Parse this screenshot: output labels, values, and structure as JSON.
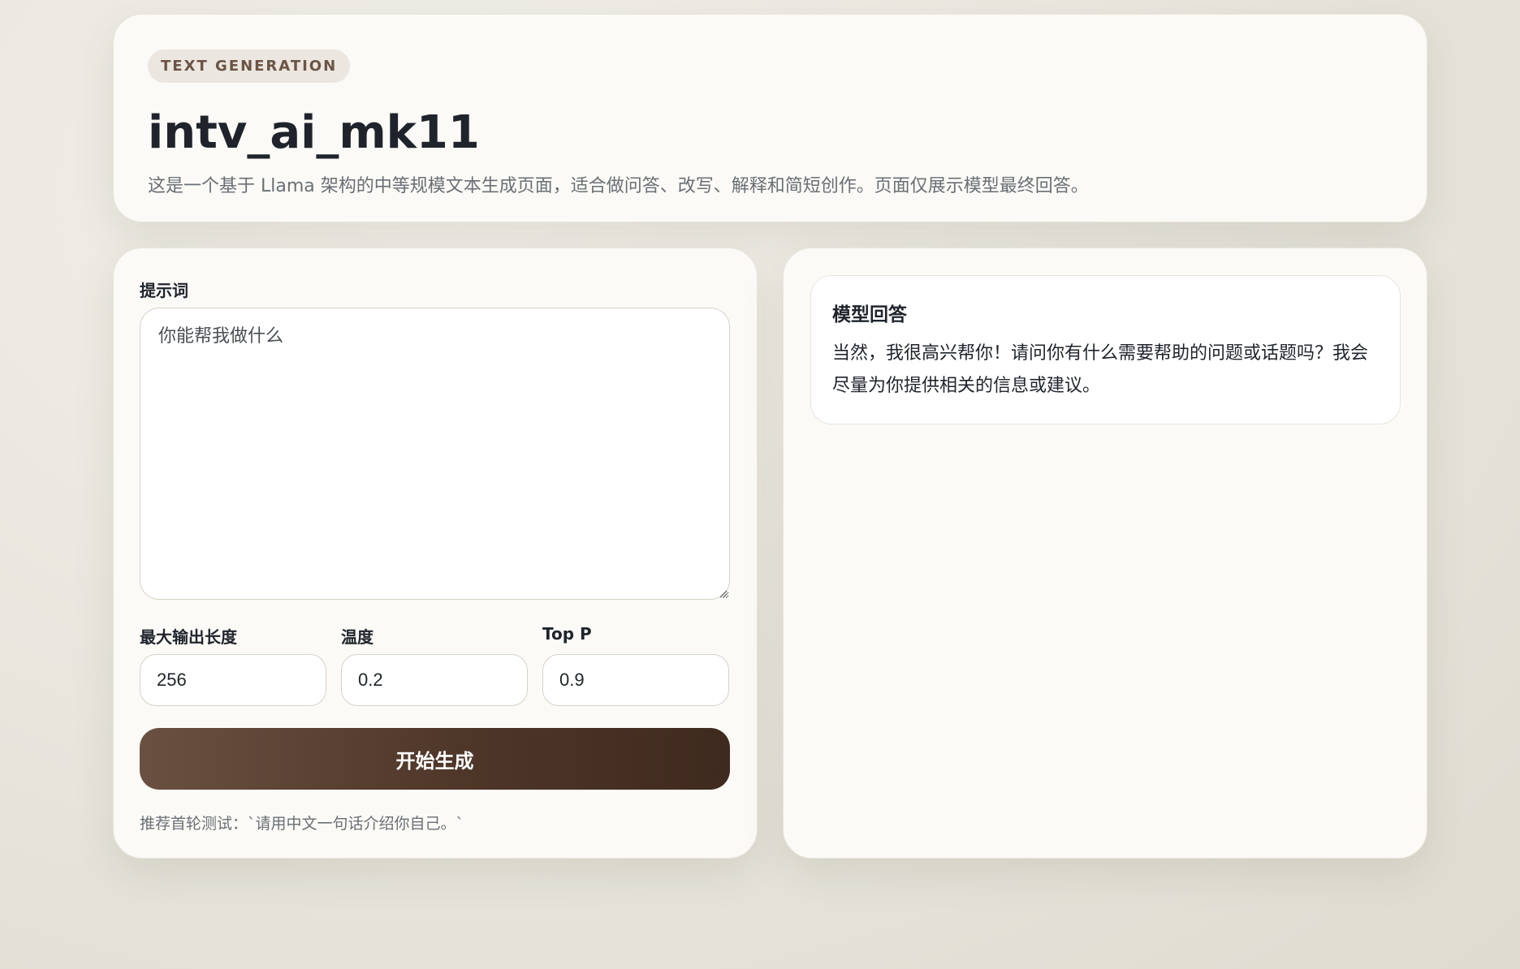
{
  "hero": {
    "badge": "TEXT GENERATION",
    "title": "intv_ai_mk11",
    "subtitle": "这是一个基于 Llama 架构的中等规模文本生成页面，适合做问答、改写、解释和简短创作。页面仅展示模型最终回答。"
  },
  "form": {
    "prompt_label": "提示词",
    "prompt_value": "你能帮我做什么",
    "max_length_label": "最大输出长度",
    "max_length_value": "256",
    "temperature_label": "温度",
    "temperature_value": "0.2",
    "top_p_label": "Top P",
    "top_p_value": "0.9",
    "submit_label": "开始生成",
    "hint": "推荐首轮测试：`请用中文一句话介绍你自己。`"
  },
  "output": {
    "title": "模型回答",
    "text": "当然，我很高兴帮你！请问你有什么需要帮助的问题或话题吗？我会尽量为你提供相关的信息或建议。"
  },
  "colors": {
    "background": "#e6e4db",
    "card": "#fbfaf6",
    "accent_brown": "#4e3629",
    "badge_bg": "#ebe6df",
    "text_dark": "#1f242c",
    "text_muted": "#6a6f75"
  }
}
